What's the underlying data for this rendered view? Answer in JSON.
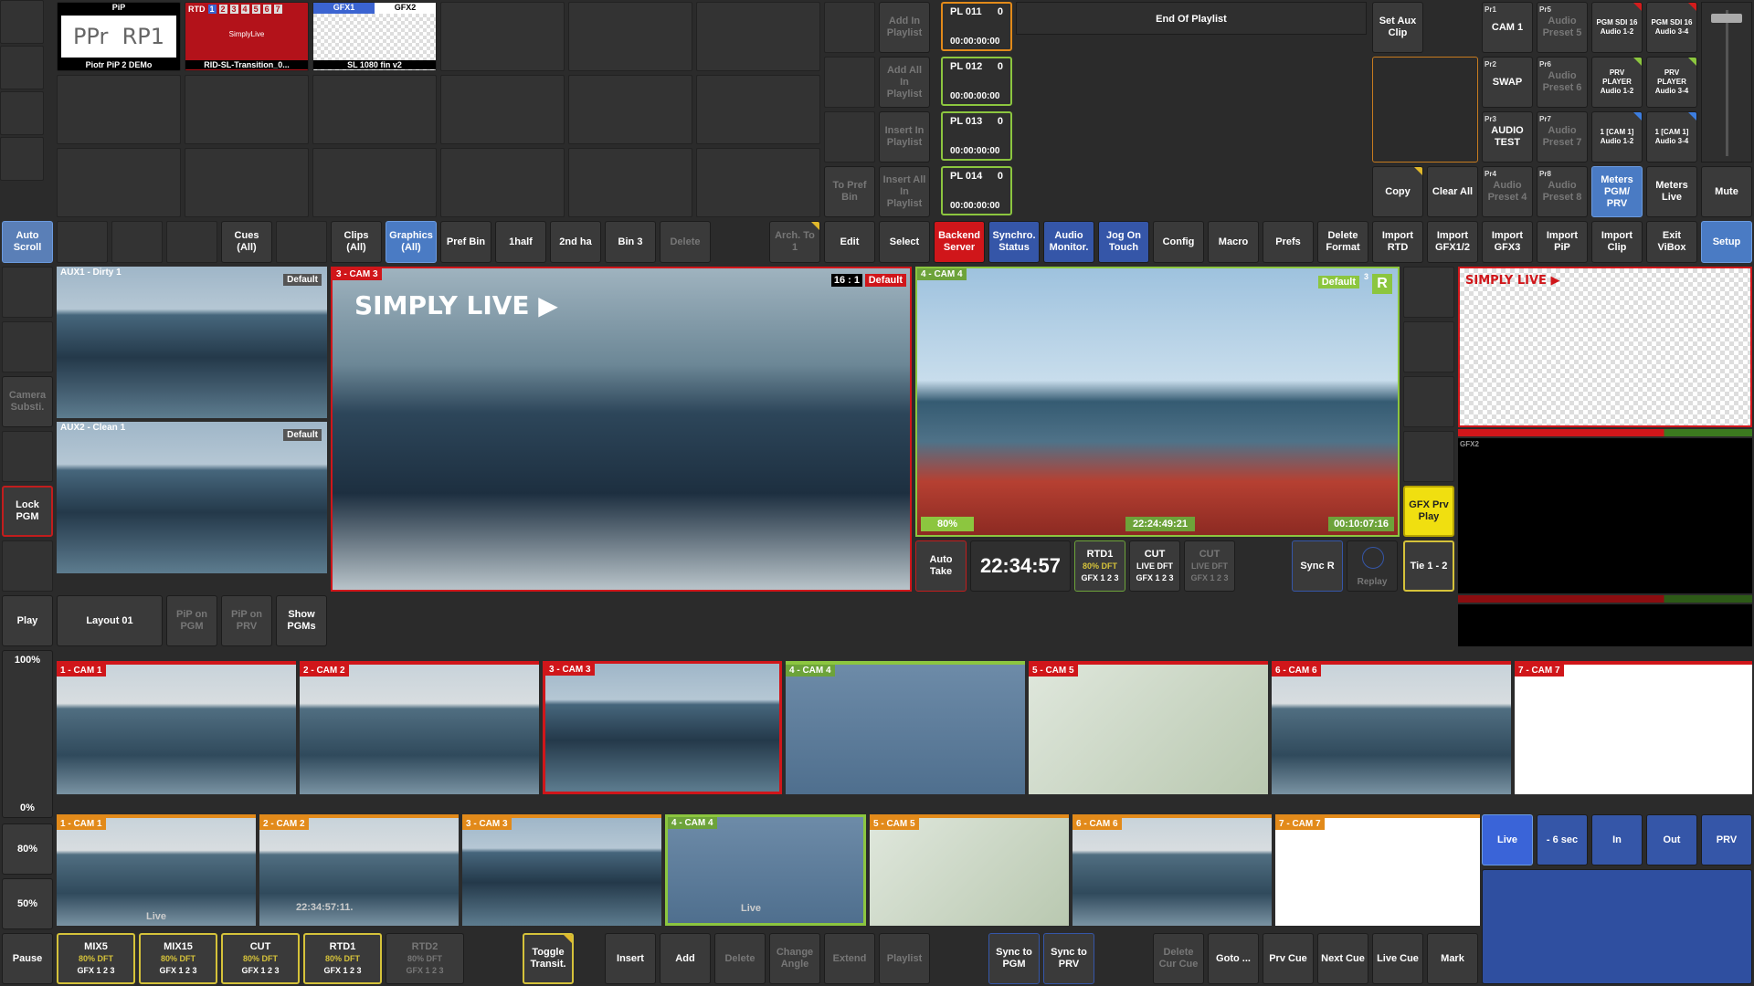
{
  "bins": {
    "tiles": [
      {
        "header": "PiP",
        "body": "PPr  RP1",
        "caption": "Piotr PiP 2 DEMo"
      },
      {
        "header": "RTD",
        "nums": [
          "1",
          "2",
          "3",
          "4",
          "5",
          "6",
          "7"
        ],
        "body": "SimplyLive",
        "caption": "RID-SL-Transition_0..."
      },
      {
        "header_a": "GFX1",
        "header_b": "GFX2",
        "caption": "SL 1080 fin v2"
      }
    ]
  },
  "playlist_buttons": [
    "Add In Playlist",
    "Add All In Playlist",
    "Insert In Playlist",
    "Insert All In Playlist"
  ],
  "to_pref_bin": "To Pref Bin",
  "playlist_items": [
    {
      "name": "PL 011",
      "count": "0",
      "time": "00:00:00:00"
    },
    {
      "name": "PL 012",
      "count": "0",
      "time": "00:00:00:00"
    },
    {
      "name": "PL 013",
      "count": "0",
      "time": "00:00:00:00"
    },
    {
      "name": "PL 014",
      "count": "0",
      "time": "00:00:00:00"
    }
  ],
  "end_of_playlist": "End Of Playlist",
  "set_aux_clip": "Set Aux Clip",
  "copy": "Copy",
  "clear_all": "Clear All",
  "presets": [
    {
      "tag": "Pr1",
      "label": "CAM 1"
    },
    {
      "tag": "Pr5",
      "label": "Audio Preset 5"
    },
    {
      "tag": "Pr2",
      "label": "SWAP"
    },
    {
      "tag": "Pr6",
      "label": "Audio Preset 6"
    },
    {
      "tag": "Pr3",
      "label": "AUDIO TEST"
    },
    {
      "tag": "Pr7",
      "label": "Audio Preset 7"
    },
    {
      "tag": "Pr4",
      "label": "Audio Preset 4"
    },
    {
      "tag": "Pr8",
      "label": "Audio Preset 8"
    }
  ],
  "audio_routes": [
    "PGM SDI 16 Audio 1-2",
    "PGM SDI 16 Audio 3-4",
    "PRV PLAYER Audio 1-2",
    "PRV PLAYER Audio 3-4",
    "1 [CAM 1] Audio 1-2",
    "1 [CAM 1] Audio 3-4"
  ],
  "meters_pgm_prv": "Meters PGM/ PRV",
  "meters_live": "Meters Live",
  "mute": "Mute",
  "toolbar": [
    "Auto Scroll",
    "Cues (All)",
    "Clips (All)",
    "Graphics (All)",
    "Pref Bin",
    "1half",
    "2nd ha",
    "Bin 3",
    "Delete",
    "Arch. To 1",
    "Edit",
    "Select",
    "Backend Server",
    "Synchro. Status",
    "Audio Monitor.",
    "Jog On Touch",
    "Config",
    "Macro",
    "Prefs",
    "Delete Format",
    "Import RTD",
    "Import GFX1/2",
    "Import GFX3",
    "Import PiP",
    "Import Clip",
    "Exit ViBox",
    "Setup"
  ],
  "left_col": {
    "camera_subst": "Camera Substi.",
    "lock_pgm": "Lock PGM",
    "play": "Play",
    "pct100": "100%",
    "pct0": "0%",
    "pct80": "80%",
    "pct50": "50%",
    "pause": "Pause"
  },
  "aux": [
    {
      "name": "AUX1 - Dirty 1",
      "tag": "Default"
    },
    {
      "name": "AUX2 - Clean 1",
      "tag": "Default"
    }
  ],
  "pgm": {
    "cam": "3 - CAM 3",
    "ratio": "16 : 1",
    "tag": "Default",
    "logo": "SIMPLY LIVE ▶"
  },
  "prv": {
    "cam": "4 - CAM 4",
    "tag": "Default",
    "sup": "3",
    "r": "R",
    "pct": "80%",
    "tc": "22:24:49:21",
    "dur": "00:10:07:16"
  },
  "gfx_prv_play": "GFX Prv Play",
  "tie": "Tie 1 - 2",
  "auto_take": "Auto Take",
  "clock": "22:34:57",
  "trans": [
    {
      "name": "RTD1",
      "sub": "80% DFT",
      "gfx": "GFX 1 2 3"
    },
    {
      "name": "CUT",
      "sub": "LIVE DFT",
      "gfx": "GFX 1 2 3"
    },
    {
      "name": "CUT",
      "sub": "LIVE DFT",
      "gfx": "GFX 1 2 3"
    }
  ],
  "sync_r": "Sync R",
  "replay": "Replay",
  "layout": {
    "layout01": "Layout 01",
    "pip_pgm": "PiP on PGM",
    "pip_prv": "PiP on PRV",
    "show_pgms": "Show PGMs"
  },
  "gfx_mon": {
    "logo": "SIMPLY LIVE ▶",
    "gfx2": "GFX2"
  },
  "cams_top": [
    "1 - CAM 1",
    "2 - CAM 2",
    "3 - CAM 3",
    "4 - CAM 4",
    "5 - CAM 5",
    "6 - CAM 6",
    "7 - CAM 7"
  ],
  "cams_bottom": [
    "1 - CAM 1",
    "2 - CAM 2",
    "3 - CAM 3",
    "4 - CAM 4",
    "5 - CAM 5",
    "6 - CAM 6",
    "7 - CAM 7"
  ],
  "cam_time": "22:34:57:11.",
  "cam_live": "Live",
  "cue_buttons": [
    "Live",
    "- 6 sec",
    "In",
    "Out",
    "PRV"
  ],
  "bottom_trans": [
    {
      "name": "MIX5",
      "sub": "80% DFT",
      "gfx": "GFX 1 2 3"
    },
    {
      "name": "MIX15",
      "sub": "80% DFT",
      "gfx": "GFX 1 2 3"
    },
    {
      "name": "CUT",
      "sub": "80% DFT",
      "gfx": "GFX 1 2 3"
    },
    {
      "name": "RTD1",
      "sub": "80% DFT",
      "gfx": "GFX 1 2 3"
    },
    {
      "name": "RTD2",
      "sub": "80% DFT",
      "gfx": "GFX 1 2 3"
    }
  ],
  "bottom_buttons": [
    "Toggle Transit.",
    "Insert",
    "Add",
    "Delete",
    "Change Angle",
    "Extend",
    "Playlist",
    "Sync to PGM",
    "Sync to PRV",
    "Delete Cur Cue",
    "Goto ...",
    "Prv Cue",
    "Next Cue",
    "Live Cue",
    "Mark"
  ],
  "colors": {
    "accent_blue": "#4a7bc4",
    "red": "#d0161a",
    "green": "#8cc63f",
    "yellow": "#f0df10"
  }
}
